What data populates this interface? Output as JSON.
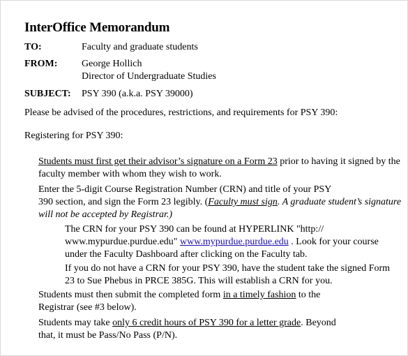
{
  "memo": {
    "title": "InterOffice Memorandum",
    "to_label": "TO:",
    "to_value": "Faculty and graduate students",
    "from_label": "FROM:",
    "from_name": "George Hollich",
    "from_title": "Director of Undergraduate Studies",
    "subject_label": "SUBJECT:",
    "subject_value": "PSY 390 (a.k.a. PSY 39000)"
  },
  "body": {
    "intro": "Please be advised of the procedures, restrictions, and requirements for PSY 390:",
    "registering_heading": "Registering for PSY 390:",
    "p1_underlined": "Students must first get their advisor’s signature on a Form 23",
    "p1_rest_line1": " prior to having it signed by the",
    "p1_line2": "faculty member with whom they wish to work.",
    "p2_line1": "Enter the 5-digit Course Registration Number (CRN) and title of your PSY",
    "p2_line2_start": "390 section, and sign the Form 23 legibly.  (",
    "p2_line2_italic_u": "Faculty must sign",
    "p2_line2_italic": ". A graduate student’s signature",
    "p2_line3_italic": "will not be accepted by Registrar.)",
    "p3_line1": "The CRN for your PSY 390 can be found at  HYPERLINK \"http://",
    "p3_line2_start": "www.mypurdue.purdue.edu\" ",
    "p3_link": "www.mypurdue.purdue.edu",
    "p3_line2_end": " .  Look for your course",
    "p3_line3": "under the Faculty Dashboard after clicking on the Faculty tab.",
    "p4_line1": "If you do not have a CRN for your PSY 390, have the student take the signed Form",
    "p4_line2": "23 to Sue Phebus in PRCE 385G. This will establish a CRN for you.",
    "p5_line1_start": "Students must then submit the completed form ",
    "p5_line1_u": "in a timely fashion",
    "p5_line1_end": " to the",
    "p5_line2": "Registrar (see #3 below).",
    "p6_line1_start": "Students may take ",
    "p6_line1_u": "only 6 credit hours of PSY 390 for a letter grade",
    "p6_line1_end": ".  Beyond",
    "p6_line2": "that, it must be Pass/No Pass (P/N)."
  }
}
